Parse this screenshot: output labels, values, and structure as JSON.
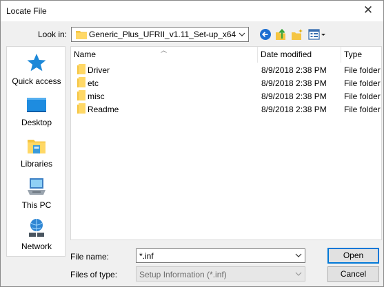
{
  "window": {
    "title": "Locate File",
    "close_glyph": "✕"
  },
  "lookin": {
    "label": "Look in:",
    "value": "Generic_Plus_UFRII_v1.11_Set-up_x64"
  },
  "toolbar": {
    "back_icon": "back-arrow-icon",
    "up_icon": "up-folder-icon",
    "newfolder_icon": "new-folder-icon",
    "view_icon": "view-menu-icon"
  },
  "places": [
    {
      "label": "Quick access",
      "icon": "star-icon"
    },
    {
      "label": "Desktop",
      "icon": "desktop-icon"
    },
    {
      "label": "Libraries",
      "icon": "libraries-icon"
    },
    {
      "label": "This PC",
      "icon": "computer-icon"
    },
    {
      "label": "Network",
      "icon": "network-icon"
    }
  ],
  "list": {
    "columns": {
      "name": "Name",
      "date": "Date modified",
      "type": "Type"
    },
    "rows": [
      {
        "name": "Driver",
        "date": "8/9/2018 2:38 PM",
        "type": "File folder"
      },
      {
        "name": "etc",
        "date": "8/9/2018 2:38 PM",
        "type": "File folder"
      },
      {
        "name": "misc",
        "date": "8/9/2018 2:38 PM",
        "type": "File folder"
      },
      {
        "name": "Readme",
        "date": "8/9/2018 2:38 PM",
        "type": "File folder"
      }
    ]
  },
  "filename": {
    "label": "File name:",
    "value": "*.inf"
  },
  "filetype": {
    "label": "Files of type:",
    "value": "Setup Information (*.inf)"
  },
  "buttons": {
    "open": "Open",
    "cancel": "Cancel"
  },
  "colors": {
    "folder": "#f5c542",
    "accent": "#0078d7"
  }
}
